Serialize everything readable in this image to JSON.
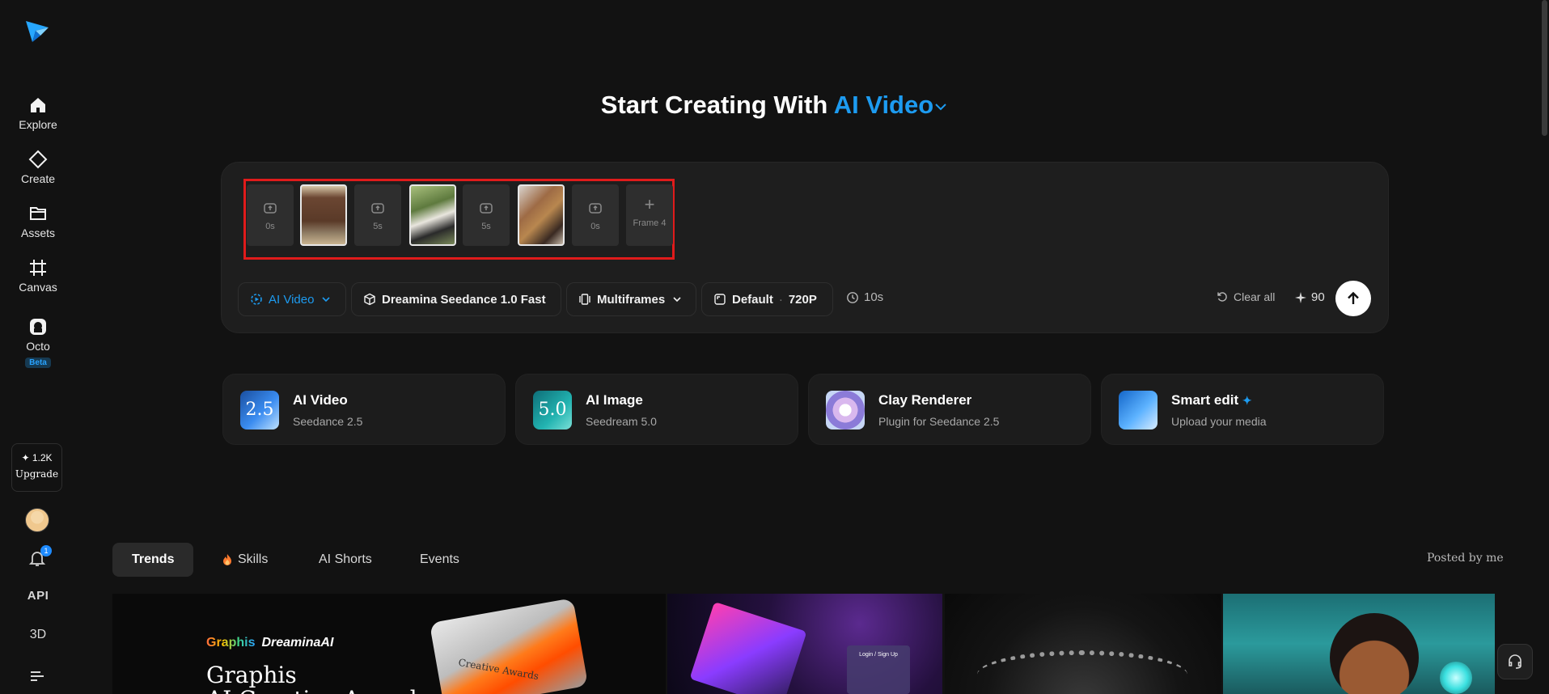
{
  "sidebar": {
    "items": [
      {
        "label": "Explore",
        "icon": "home-icon"
      },
      {
        "label": "Create",
        "icon": "diamond-icon"
      },
      {
        "label": "Assets",
        "icon": "folder-icon"
      },
      {
        "label": "Canvas",
        "icon": "frame-icon"
      },
      {
        "label": "Octo",
        "icon": "octo-icon"
      }
    ],
    "beta_label": "Beta",
    "credits": "1.2K",
    "upgrade_label": "Upgrade",
    "notification_count": "1",
    "api_label": "API",
    "threed_label": "3D"
  },
  "heading": {
    "prefix": "Start Creating With",
    "mode": "AI Video"
  },
  "frames": [
    {
      "type": "slot",
      "duration": "0s"
    },
    {
      "type": "image"
    },
    {
      "type": "slot",
      "duration": "5s"
    },
    {
      "type": "image"
    },
    {
      "type": "slot",
      "duration": "5s"
    },
    {
      "type": "image"
    },
    {
      "type": "slot",
      "duration": "0s"
    },
    {
      "type": "add",
      "label": "Frame 4"
    }
  ],
  "toolbar": {
    "mode_label": "AI Video",
    "model_label": "Dreamina Seedance 1.0 Fast",
    "frames_label": "Multiframes",
    "ratio_label": "Default",
    "separator": "·",
    "resolution_label": "720P",
    "duration_label": "10s",
    "clear_label": "Clear all",
    "cost": "90"
  },
  "cards": [
    {
      "title": "AI Video",
      "subtitle": "Seedance 2.5",
      "badge": "2.5"
    },
    {
      "title": "AI Image",
      "subtitle": "Seedream 5.0",
      "badge": "5.0"
    },
    {
      "title": "Clay Renderer",
      "subtitle": "Plugin for Seedance 2.5"
    },
    {
      "title": "Smart edit",
      "subtitle": "Upload your media"
    }
  ],
  "tabs": [
    {
      "label": "Trends",
      "active": true
    },
    {
      "label": "Skills",
      "active": false
    },
    {
      "label": "AI Shorts",
      "active": false
    },
    {
      "label": "Events",
      "active": false
    }
  ],
  "posted_label": "Posted by me",
  "gallery": {
    "g1_brand_left": "Graphis",
    "g1_brand_right": "DreaminaAI",
    "g1_headline": "Graphis\nAI Creative Award",
    "g1_award": "Creative Awards",
    "g2_login": "Login / Sign Up"
  },
  "colors": {
    "accent": "#1d9bf0",
    "background": "#121212",
    "frame_highlight": "#e01b1b"
  }
}
